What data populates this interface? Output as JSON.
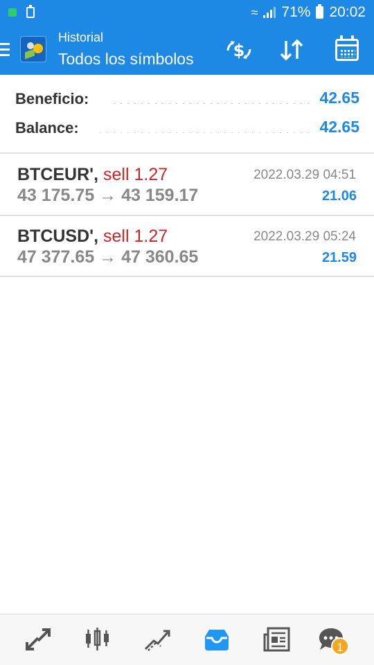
{
  "status_bar": {
    "battery": "71%",
    "time": "20:02"
  },
  "app_bar": {
    "subtitle": "Historial",
    "title": "Todos los símbolos"
  },
  "summary": {
    "rows": [
      {
        "label": "Beneficio:",
        "value": "42.65"
      },
      {
        "label": "Balance:",
        "value": "42.65"
      }
    ]
  },
  "trades": [
    {
      "symbol": "BTCEUR',",
      "side": "sell 1.27",
      "prices": "43 175.75 → 43 159.17",
      "time": "2022.03.29 04:51",
      "profit": "21.06"
    },
    {
      "symbol": "BTCUSD',",
      "side": "sell 1.27",
      "prices": "47 377.65 → 47 360.65",
      "time": "2022.03.29 05:24",
      "profit": "21.59"
    }
  ],
  "bottom_nav": {
    "items": [
      "quotes-icon",
      "chart-icon",
      "trade-icon",
      "history-icon",
      "news-icon",
      "chat-icon"
    ],
    "chat_badge": "1",
    "active": "history-icon",
    "active_color": "#2196f3",
    "inactive_color": "#555555"
  },
  "colors": {
    "primary": "#1e88e5",
    "sell": "#c62828",
    "profit": "#1e88e5"
  }
}
